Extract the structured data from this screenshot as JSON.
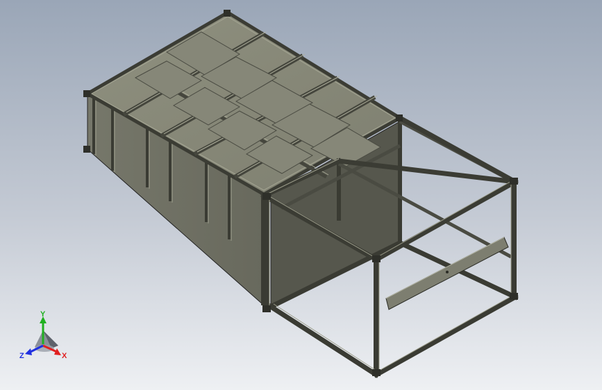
{
  "window": {
    "title": ""
  },
  "model": {
    "name": ""
  },
  "triad": {
    "x_label": "X",
    "y_label": "Y",
    "z_label": "Z",
    "x_color": "#e02020",
    "y_color": "#20b020",
    "z_color": "#2030e0"
  },
  "colors": {
    "background_top": "#9aa6b7",
    "background_bottom": "#eef0f3",
    "frame": "#55564d",
    "panel": "#7b7c6e",
    "panel_light": "#8f907f",
    "edge": "#202020"
  }
}
